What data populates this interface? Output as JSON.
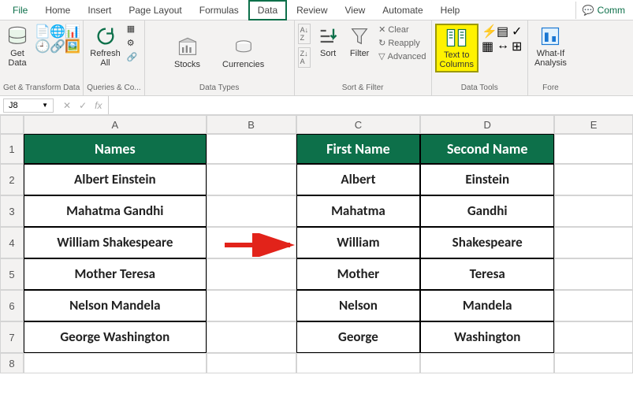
{
  "tabs": {
    "file": "File",
    "home": "Home",
    "insert": "Insert",
    "pagelayout": "Page Layout",
    "formulas": "Formulas",
    "data": "Data",
    "review": "Review",
    "view": "View",
    "automate": "Automate",
    "help": "Help",
    "comm": "Comm"
  },
  "ribbon": {
    "getdata": "Get\nData",
    "gt_label": "Get & Transform Data",
    "refresh": "Refresh\nAll",
    "qc_label": "Queries & Co...",
    "stocks": "Stocks",
    "currencies": "Currencies",
    "dt_label": "Data Types",
    "sortaz": "A→Z",
    "sortza": "Z→A",
    "sort": "Sort",
    "filter": "Filter",
    "clear": "Clear",
    "reapply": "Reapply",
    "advanced": "Advanced",
    "sf_label": "Sort & Filter",
    "t2c": "Text to\nColumns",
    "dtools_label": "Data Tools",
    "whatif": "What-If\nAnalysis",
    "f_label": "Fore"
  },
  "namebox": "J8",
  "cols": [
    "A",
    "B",
    "C",
    "D",
    "E"
  ],
  "rowlabels": [
    "1",
    "2",
    "3",
    "4",
    "5",
    "6",
    "7",
    "8"
  ],
  "headers": {
    "a": "Names",
    "c": "First Name",
    "d": "Second Name"
  },
  "dataA": [
    "Albert Einstein",
    "Mahatma Gandhi",
    "William Shakespeare",
    "Mother Teresa",
    "Nelson Mandela",
    "George Washington"
  ],
  "dataC": [
    "Albert",
    "Mahatma",
    "William",
    "Mother",
    "Nelson",
    "George"
  ],
  "dataD": [
    "Einstein",
    "Gandhi",
    "Shakespeare",
    "Teresa",
    "Mandela",
    "Washington"
  ]
}
